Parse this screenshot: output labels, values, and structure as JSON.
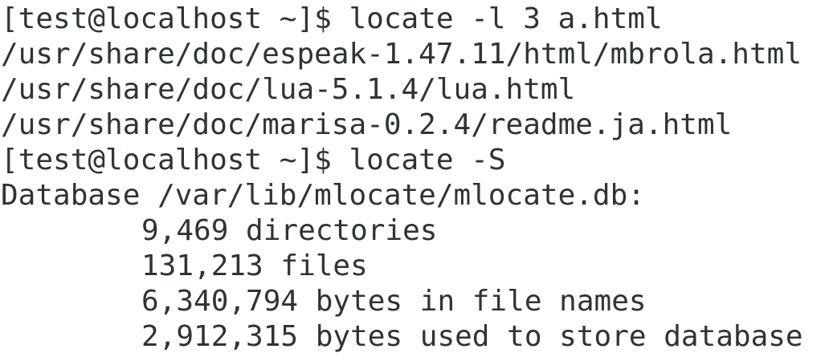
{
  "terminal": {
    "lines": [
      {
        "kind": "command",
        "prompt": "[test@localhost ~]$ ",
        "command": "locate -l 3 a.html"
      },
      {
        "kind": "output",
        "text": "/usr/share/doc/espeak-1.47.11/html/mbrola.html"
      },
      {
        "kind": "output",
        "text": "/usr/share/doc/lua-5.1.4/lua.html"
      },
      {
        "kind": "output",
        "text": "/usr/share/doc/marisa-0.2.4/readme.ja.html"
      },
      {
        "kind": "command",
        "prompt": "[test@localhost ~]$ ",
        "command": "locate -S"
      },
      {
        "kind": "output",
        "text": "Database /var/lib/mlocate/mlocate.db:"
      },
      {
        "kind": "stat",
        "text": "9,469 directories"
      },
      {
        "kind": "stat",
        "text": "131,213 files"
      },
      {
        "kind": "stat",
        "text": "6,340,794 bytes in file names"
      },
      {
        "kind": "stat",
        "text": "2,912,315 bytes used to store database"
      }
    ]
  },
  "colors": {
    "background": "#ffffff",
    "text": "#2e3436"
  }
}
